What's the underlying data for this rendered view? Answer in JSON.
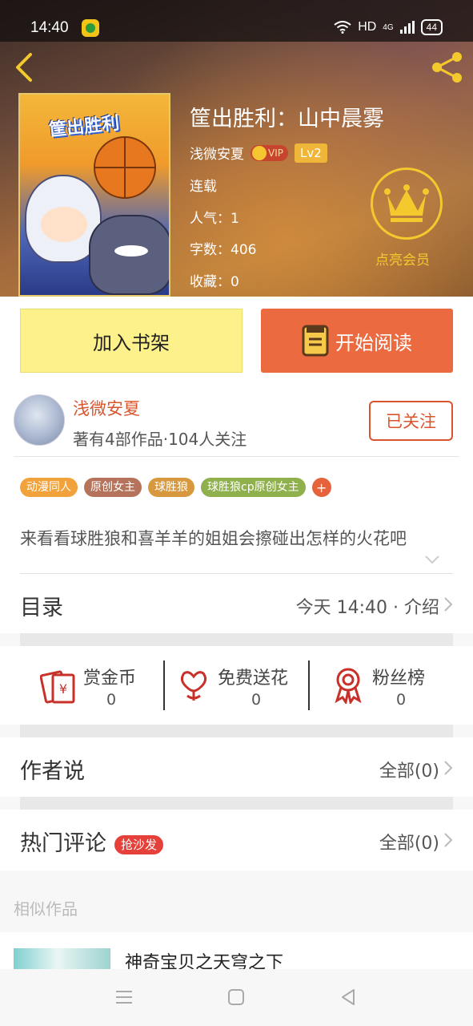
{
  "status_bar": {
    "time": "14:40",
    "network": "HD",
    "network_type": "4G",
    "battery": "44"
  },
  "book": {
    "title": "筐出胜利：山中晨雾",
    "author": "浅微安夏",
    "vip_badge": "VIP",
    "level": "Lv2",
    "status": "连载",
    "popularity": "人气：1",
    "word_count": "字数：406",
    "favorites": "收藏：0",
    "cover_text": "筐出胜利"
  },
  "vip_cta": {
    "label": "点亮会员"
  },
  "actions": {
    "add_shelf": "加入书架",
    "start_reading": "开始阅读"
  },
  "author_card": {
    "name": "浅微安夏",
    "stats": "著有4部作品·104人关注",
    "follow_label": "已关注"
  },
  "tags": [
    {
      "label": "动漫同人",
      "color": "#f2a23a"
    },
    {
      "label": "原创女主",
      "color": "#b5735c"
    },
    {
      "label": "球胜狼",
      "color": "#d8993e"
    },
    {
      "label": "球胜狼cp原创女主",
      "color": "#8fb04d"
    }
  ],
  "tag_add": "+",
  "description": "来看看球胜狼和喜羊羊的姐姐会擦碰出怎样的火花吧",
  "catalog": {
    "title": "目录",
    "right": "今天 14:40 · 介绍"
  },
  "rewards": [
    {
      "label": "赏金币",
      "value": "0",
      "icon": "red-envelope-icon"
    },
    {
      "label": "免费送花",
      "value": "0",
      "icon": "flower-icon"
    },
    {
      "label": "粉丝榜",
      "value": "0",
      "icon": "medal-icon"
    }
  ],
  "author_says": {
    "title": "作者说",
    "right": "全部(0)"
  },
  "hot_comments": {
    "title": "热门评论",
    "badge": "抢沙发",
    "right": "全部(0)"
  },
  "similar": {
    "label": "相似作品",
    "first_title": "神奇宝贝之天穹之下"
  },
  "colors": {
    "accent": "#eb6a3f",
    "shelf_button": "#fcf18a",
    "vip_gold": "#f3c92e",
    "author_red": "#d9552e"
  }
}
